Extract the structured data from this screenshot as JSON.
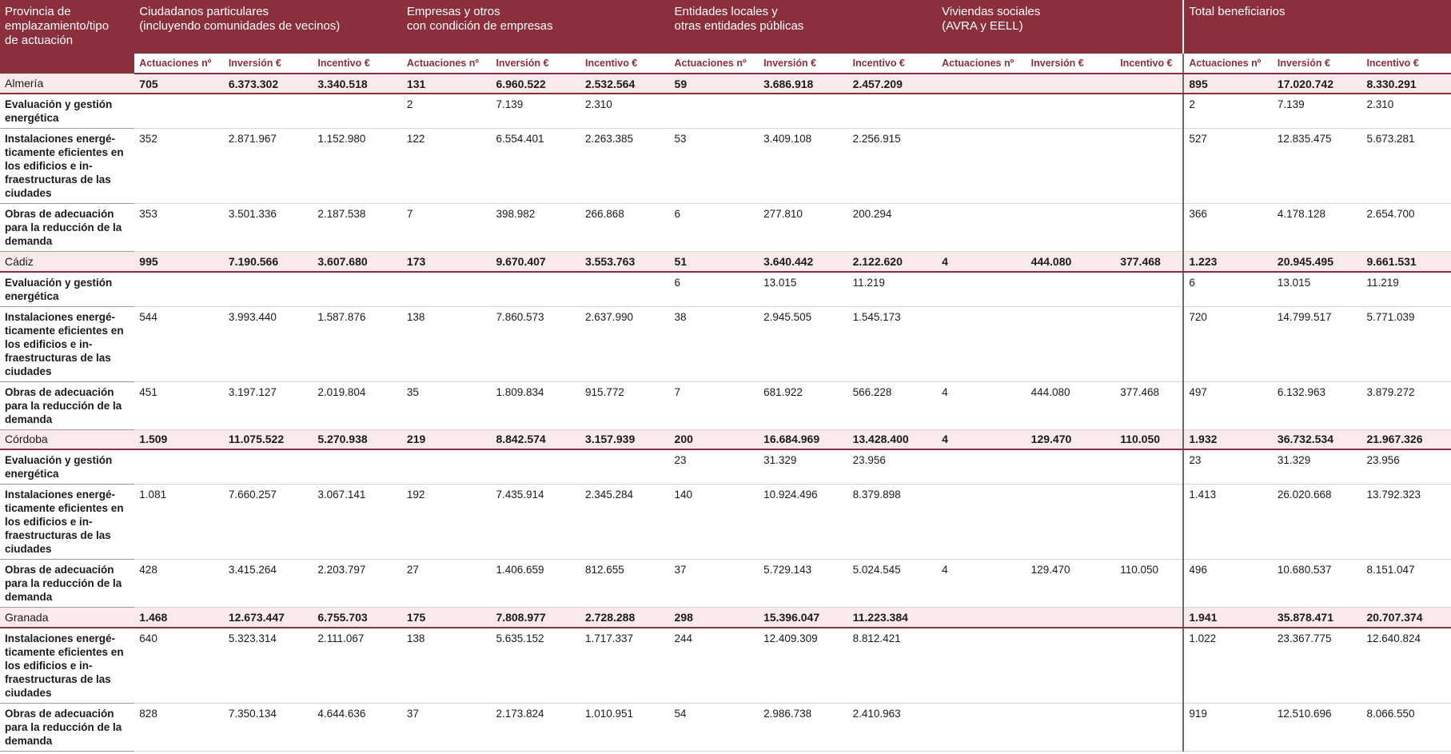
{
  "header": {
    "groups": [
      "Provincia de\nemplazamiento/tipo\nde actuación",
      "Ciudadanos particulares\n(incluyendo comunidades de vecinos)",
      "Empresas y otros\ncon condición de empresas",
      "Entidades locales y\notras entidades públicas",
      "Viviendas sociales\n(AVRA y EELL)",
      "Total beneficiarios"
    ],
    "subcols": [
      "Actuaciones nº",
      "Inversión €",
      "Incentivo €"
    ]
  },
  "rows": [
    {
      "type": "prov",
      "name": "Almería",
      "cells": [
        "705",
        "6.373.302",
        "3.340.518",
        "131",
        "6.960.522",
        "2.532.564",
        "59",
        "3.686.918",
        "2.457.209",
        "",
        "",
        "",
        "895",
        "17.020.742",
        "8.330.291"
      ]
    },
    {
      "type": "det",
      "name": "Evaluación y gestión energética",
      "cells": [
        "",
        "",
        "",
        "2",
        "7.139",
        "2.310",
        "",
        "",
        "",
        "",
        "",
        "",
        "2",
        "7.139",
        "2.310"
      ]
    },
    {
      "type": "det",
      "name": "Instalaciones energé-ticamente eficientes en los edificios e in-fraestructuras de las ciudades",
      "cells": [
        "352",
        "2.871.967",
        "1.152.980",
        "122",
        "6.554.401",
        "2.263.385",
        "53",
        "3.409.108",
        "2.256.915",
        "",
        "",
        "",
        "527",
        "12.835.475",
        "5.673.281"
      ]
    },
    {
      "type": "det",
      "name": "Obras de adecuación para la reducción de la demanda",
      "cells": [
        "353",
        "3.501.336",
        "2.187.538",
        "7",
        "398.982",
        "266.868",
        "6",
        "277.810",
        "200.294",
        "",
        "",
        "",
        "366",
        "4.178.128",
        "2.654.700"
      ]
    },
    {
      "type": "prov",
      "name": "Cádiz",
      "cells": [
        "995",
        "7.190.566",
        "3.607.680",
        "173",
        "9.670.407",
        "3.553.763",
        "51",
        "3.640.442",
        "2.122.620",
        "4",
        "444.080",
        "377.468",
        "1.223",
        "20.945.495",
        "9.661.531"
      ]
    },
    {
      "type": "det",
      "name": "Evaluación y gestión energética",
      "cells": [
        "",
        "",
        "",
        "",
        "",
        "",
        "6",
        "13.015",
        "11.219",
        "",
        "",
        "",
        "6",
        "13.015",
        "11.219"
      ]
    },
    {
      "type": "det",
      "name": "Instalaciones energé-ticamente eficientes en los edificios e in-fraestructuras de las ciudades",
      "cells": [
        "544",
        "3.993.440",
        "1.587.876",
        "138",
        "7.860.573",
        "2.637.990",
        "38",
        "2.945.505",
        "1.545.173",
        "",
        "",
        "",
        "720",
        "14.799.517",
        "5.771.039"
      ]
    },
    {
      "type": "det",
      "name": "Obras de adecuación para la reducción de la demanda",
      "cells": [
        "451",
        "3.197.127",
        "2.019.804",
        "35",
        "1.809.834",
        "915.772",
        "7",
        "681.922",
        "566.228",
        "4",
        "444.080",
        "377.468",
        "497",
        "6.132.963",
        "3.879.272"
      ]
    },
    {
      "type": "prov",
      "name": "Córdoba",
      "cells": [
        "1.509",
        "11.075.522",
        "5.270.938",
        "219",
        "8.842.574",
        "3.157.939",
        "200",
        "16.684.969",
        "13.428.400",
        "4",
        "129.470",
        "110.050",
        "1.932",
        "36.732.534",
        "21.967.326"
      ]
    },
    {
      "type": "det",
      "name": "Evaluación y gestión energética",
      "cells": [
        "",
        "",
        "",
        "",
        "",
        "",
        "23",
        "31.329",
        "23.956",
        "",
        "",
        "",
        "23",
        "31.329",
        "23.956"
      ]
    },
    {
      "type": "det",
      "name": "Instalaciones energé-ticamente eficientes en los edificios e in-fraestructuras de las ciudades",
      "cells": [
        "1.081",
        "7.660.257",
        "3.067.141",
        "192",
        "7.435.914",
        "2.345.284",
        "140",
        "10.924.496",
        "8.379.898",
        "",
        "",
        "",
        "1.413",
        "26.020.668",
        "13.792.323"
      ]
    },
    {
      "type": "det",
      "name": "Obras de adecuación para la reducción de la demanda",
      "cells": [
        "428",
        "3.415.264",
        "2.203.797",
        "27",
        "1.406.659",
        "812.655",
        "37",
        "5.729.143",
        "5.024.545",
        "4",
        "129.470",
        "110.050",
        "496",
        "10.680.537",
        "8.151.047"
      ]
    },
    {
      "type": "prov",
      "name": "Granada",
      "cells": [
        "1.468",
        "12.673.447",
        "6.755.703",
        "175",
        "7.808.977",
        "2.728.288",
        "298",
        "15.396.047",
        "11.223.384",
        "",
        "",
        "",
        "1.941",
        "35.878.471",
        "20.707.374"
      ]
    },
    {
      "type": "det",
      "name": "Instalaciones energé-ticamente eficientes en los edificios e in-fraestructuras de las ciudades",
      "cells": [
        "640",
        "5.323.314",
        "2.111.067",
        "138",
        "5.635.152",
        "1.717.337",
        "244",
        "12.409.309",
        "8.812.421",
        "",
        "",
        "",
        "1.022",
        "23.367.775",
        "12.640.824"
      ]
    },
    {
      "type": "det",
      "name": "Obras de adecuación para la reducción de la demanda",
      "cells": [
        "828",
        "7.350.134",
        "4.644.636",
        "37",
        "2.173.824",
        "1.010.951",
        "54",
        "2.986.738",
        "2.410.963",
        "",
        "",
        "",
        "919",
        "12.510.696",
        "8.066.550"
      ]
    }
  ]
}
